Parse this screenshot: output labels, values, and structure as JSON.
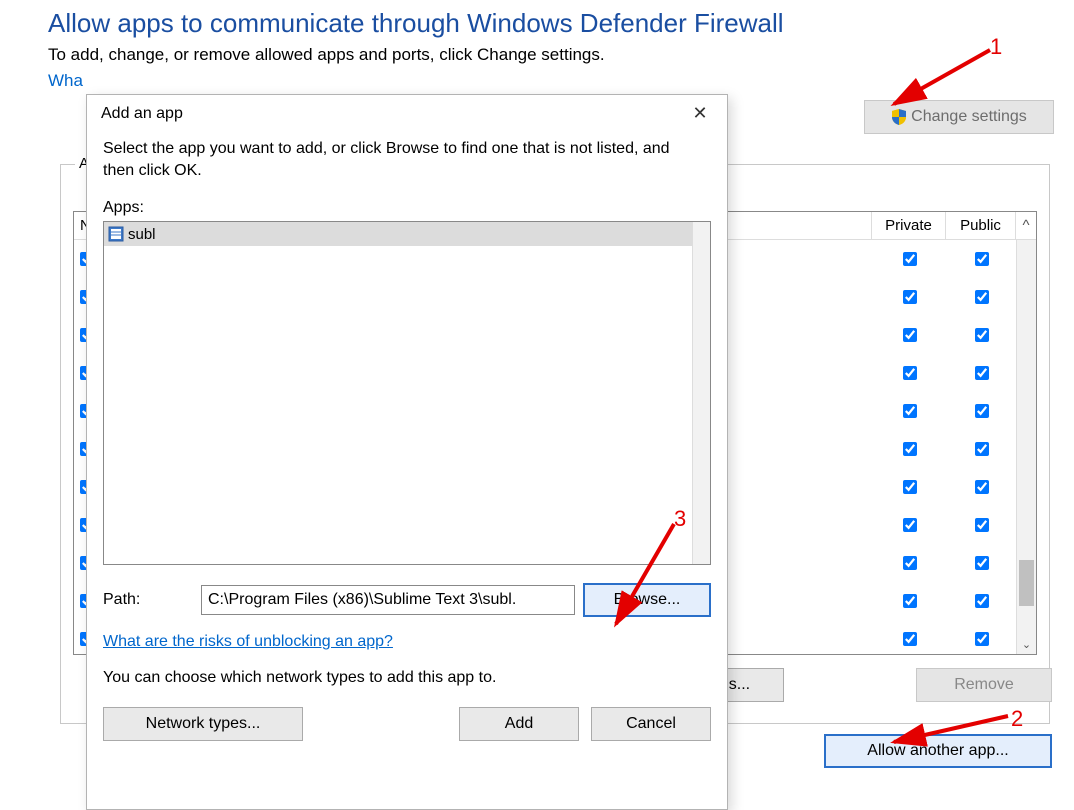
{
  "page": {
    "title": "Allow apps to communicate through Windows Defender Firewall",
    "subtitle": "To add, change, or remove allowed apps and ports, click Change settings.",
    "risks_link_partial": "Wha"
  },
  "buttons": {
    "change_settings": "Change settings",
    "details": "Details...",
    "remove": "Remove",
    "allow_another": "Allow another app..."
  },
  "table": {
    "group_label_partial": "A",
    "head_name_partial": "N",
    "head_private": "Private",
    "head_public": "Public",
    "head_scroll_caret": "^",
    "rows": [
      {
        "name_checked": true,
        "private": true,
        "public": true
      },
      {
        "name_checked": true,
        "private": true,
        "public": true
      },
      {
        "name_checked": true,
        "private": true,
        "public": true
      },
      {
        "name_checked": true,
        "private": true,
        "public": true
      },
      {
        "name_checked": true,
        "private": true,
        "public": true
      },
      {
        "name_checked": true,
        "private": true,
        "public": true
      },
      {
        "name_checked": true,
        "private": true,
        "public": true
      },
      {
        "name_checked": true,
        "private": true,
        "public": true
      },
      {
        "name_checked": true,
        "private": true,
        "public": true
      },
      {
        "name_checked": true,
        "private": true,
        "public": true
      },
      {
        "name_checked": true,
        "private": true,
        "public": true
      }
    ],
    "scroll_down_glyph": "⌄"
  },
  "dialog": {
    "title": "Add an app",
    "instruction": "Select the app you want to add, or click Browse to find one that is not listed, and then click OK.",
    "apps_label": "Apps:",
    "apps": [
      {
        "name": "subl",
        "selected": true
      }
    ],
    "path_label": "Path:",
    "path_value": "C:\\Program Files (x86)\\Sublime Text 3\\subl.",
    "browse": "Browse...",
    "risks_link": "What are the risks of unblocking an app?",
    "choose_text": "You can choose which network types to add this app to.",
    "network_types": "Network types...",
    "add": "Add",
    "cancel": "Cancel"
  },
  "annotations": {
    "n1": "1",
    "n2": "2",
    "n3": "3"
  }
}
